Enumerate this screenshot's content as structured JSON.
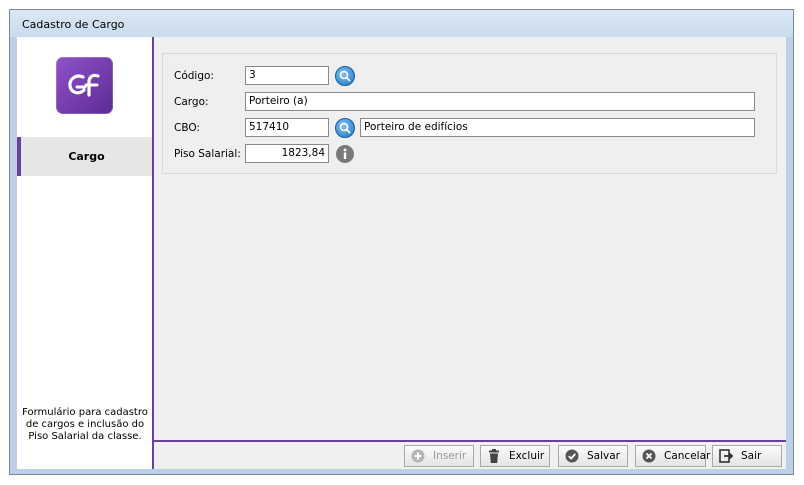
{
  "window": {
    "title": "Cadastro de Cargo"
  },
  "sidebar": {
    "item_label": "Cargo",
    "description": "Formulário para cadastro de cargos e inclusão do Piso Salarial da classe."
  },
  "form": {
    "codigo": {
      "label": "Código:",
      "value": "3"
    },
    "cargo": {
      "label": "Cargo:",
      "value": "Porteiro (a)"
    },
    "cbo": {
      "label": "CBO:",
      "value": "517410",
      "description": "Porteiro de edifícios"
    },
    "piso": {
      "label": "Piso Salarial:",
      "value": "1823,84"
    }
  },
  "toolbar": {
    "inserir": "Inserir",
    "excluir": "Excluir",
    "salvar": "Salvar",
    "cancelar": "Cancelar",
    "sair": "Sair"
  },
  "colors": {
    "accent": "#6b3fa0",
    "search": "#1f74c4"
  },
  "icons": [
    "logo-icon",
    "search-icon",
    "info-icon",
    "plus-circle-icon",
    "trash-icon",
    "check-circle-icon",
    "cancel-circle-icon",
    "exit-icon"
  ]
}
